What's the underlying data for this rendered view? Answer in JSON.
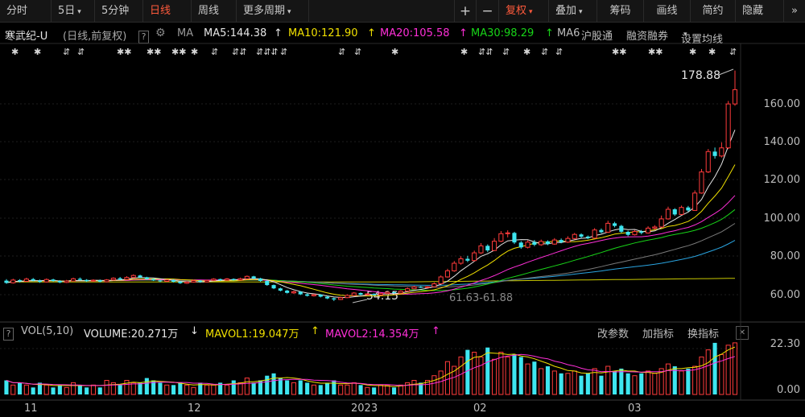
{
  "toolbar": {
    "tabs": [
      {
        "label": "分时",
        "active": false
      },
      {
        "label": "5日",
        "active": false,
        "caret": true
      },
      {
        "label": "5分钟",
        "active": false
      },
      {
        "label": "日线",
        "active": true
      },
      {
        "label": "周线",
        "active": false
      },
      {
        "label": "更多周期",
        "active": false,
        "caret": true
      }
    ],
    "zoom_in": "+",
    "zoom_out": "−",
    "fuquan": "复权",
    "overlay": "叠加",
    "chips": "筹码",
    "draw": "画线",
    "simple": "简约",
    "hide": "隐藏",
    "expand": "»"
  },
  "info": {
    "stock_name": "寒武纪-U",
    "desc": "(日线,前复权)",
    "help": "?",
    "ma_label": "MA",
    "ma5": "MA5:144.38",
    "ma10": "MA10:121.90",
    "ma20": "MA20:105.58",
    "ma30": "MA30:98.29",
    "ma6": "MA6",
    "hugutong": "沪股通",
    "rongzi": "融资融券",
    "settings": "设置均线"
  },
  "volume_info": {
    "vol": "VOL(5,10)",
    "volume": "VOLUME:20.271万",
    "mavol1": "MAVOL1:19.047万",
    "mavol2": "MAVOL2:14.354万",
    "edit_params": "改参数",
    "add_indicator": "加指标",
    "switch_indicator": "换指标",
    "close": "✕"
  },
  "colors": {
    "up": "#ff3b3b",
    "down": "#3ee6f0",
    "ma5": "#e6e6e6",
    "ma10": "#f0e000",
    "ma20": "#ff2fd8",
    "ma30": "#18d418",
    "ma60": "#7a7a7a",
    "ma120": "#2aa4e0",
    "ma250": "#c8c800"
  },
  "chart_data": {
    "type": "candlestick",
    "price_axis_ticks": [
      "160.00",
      "140.00",
      "120.00",
      "100.00",
      "80.00",
      "60.00"
    ],
    "volume_axis_ticks": [
      "22.30",
      "0.00"
    ],
    "x_labels": [
      "11",
      "12",
      "2023",
      "02",
      "03"
    ],
    "annotations": {
      "high": "178.88",
      "low": "54.15",
      "range": "61.63-61.88"
    },
    "price_range": [
      55,
      180
    ],
    "candles": [
      [
        65.2,
        64.0,
        66.0,
        63.5
      ],
      [
        64.0,
        65.5,
        66.2,
        63.6
      ],
      [
        65.5,
        64.8,
        66.0,
        64.2
      ],
      [
        64.8,
        66.0,
        66.8,
        64.5
      ],
      [
        66.0,
        65.2,
        66.6,
        64.8
      ],
      [
        65.2,
        64.5,
        65.8,
        64.0
      ],
      [
        64.5,
        65.8,
        66.4,
        64.2
      ],
      [
        65.8,
        65.0,
        66.2,
        64.6
      ],
      [
        65.0,
        64.2,
        65.5,
        63.8
      ],
      [
        64.2,
        65.0,
        65.6,
        63.9
      ],
      [
        65.0,
        66.2,
        66.8,
        64.8
      ],
      [
        66.2,
        65.6,
        66.9,
        65.2
      ],
      [
        65.6,
        64.9,
        66.0,
        64.5
      ],
      [
        64.9,
        65.4,
        65.9,
        64.5
      ],
      [
        65.4,
        64.6,
        65.8,
        64.2
      ],
      [
        64.6,
        65.6,
        66.0,
        64.3
      ],
      [
        65.6,
        66.5,
        67.0,
        65.3
      ],
      [
        66.5,
        65.8,
        67.2,
        65.4
      ],
      [
        65.8,
        66.9,
        67.6,
        65.6
      ],
      [
        66.9,
        68.0,
        68.6,
        66.5
      ],
      [
        68.0,
        67.0,
        68.4,
        66.6
      ],
      [
        67.0,
        66.0,
        67.3,
        65.6
      ],
      [
        66.0,
        65.3,
        66.4,
        65.0
      ],
      [
        65.3,
        64.8,
        65.6,
        64.3
      ],
      [
        64.8,
        65.6,
        66.0,
        64.5
      ],
      [
        65.6,
        64.6,
        65.9,
        64.2
      ],
      [
        64.6,
        63.8,
        65.0,
        63.4
      ],
      [
        63.8,
        64.4,
        64.8,
        63.4
      ],
      [
        64.4,
        65.2,
        65.6,
        64.1
      ],
      [
        65.2,
        64.5,
        65.5,
        64.0
      ],
      [
        64.5,
        65.3,
        65.7,
        64.2
      ],
      [
        65.3,
        66.0,
        66.5,
        65.0
      ],
      [
        66.0,
        65.4,
        66.3,
        65.0
      ],
      [
        65.4,
        66.1,
        66.6,
        65.1
      ],
      [
        66.1,
        65.5,
        66.4,
        65.2
      ],
      [
        65.5,
        66.2,
        66.8,
        65.2
      ],
      [
        66.2,
        67.5,
        68.0,
        66.0
      ],
      [
        67.5,
        66.4,
        67.8,
        66.0
      ],
      [
        66.4,
        65.0,
        66.7,
        64.6
      ],
      [
        65.0,
        62.8,
        65.3,
        62.4
      ],
      [
        62.8,
        61.0,
        63.1,
        60.6
      ],
      [
        61.0,
        59.8,
        61.4,
        59.4
      ],
      [
        59.8,
        58.6,
        60.2,
        58.2
      ],
      [
        58.6,
        59.2,
        59.8,
        58.0
      ],
      [
        59.2,
        57.8,
        59.5,
        57.4
      ],
      [
        57.8,
        57.0,
        58.2,
        56.6
      ],
      [
        57.0,
        57.6,
        58.0,
        56.6
      ],
      [
        57.6,
        56.5,
        57.9,
        56.1
      ],
      [
        56.5,
        55.6,
        56.9,
        55.2
      ],
      [
        55.6,
        55.0,
        56.0,
        54.15
      ],
      [
        55.0,
        56.0,
        56.5,
        54.7
      ],
      [
        56.0,
        57.2,
        57.8,
        55.8
      ],
      [
        57.2,
        58.5,
        59.0,
        57.0
      ],
      [
        58.5,
        57.6,
        58.8,
        57.2
      ],
      [
        57.6,
        58.0,
        58.4,
        57.2
      ],
      [
        58.0,
        57.4,
        58.3,
        57.0
      ],
      [
        57.4,
        58.2,
        58.7,
        57.1
      ],
      [
        58.2,
        58.9,
        59.3,
        58.0
      ],
      [
        58.9,
        58.5,
        59.2,
        58.1
      ],
      [
        58.5,
        59.5,
        60.0,
        58.3
      ],
      [
        59.5,
        60.8,
        61.5,
        59.3
      ],
      [
        60.8,
        61.8,
        62.4,
        60.6
      ],
      [
        61.8,
        61.6,
        62.3,
        61.2
      ],
      [
        61.6,
        61.88,
        62.2,
        61.3
      ],
      [
        61.9,
        63.5,
        64.2,
        61.7
      ],
      [
        63.5,
        67.2,
        68.0,
        63.2
      ],
      [
        67.2,
        70.5,
        71.6,
        66.8
      ],
      [
        70.5,
        74.6,
        75.8,
        70.0
      ],
      [
        74.6,
        77.0,
        78.4,
        73.8
      ],
      [
        77.0,
        76.0,
        78.6,
        75.2
      ],
      [
        76.0,
        80.2,
        81.4,
        75.6
      ],
      [
        80.2,
        84.0,
        85.5,
        79.6
      ],
      [
        84.0,
        81.5,
        84.8,
        80.6
      ],
      [
        81.5,
        86.5,
        88.2,
        81.2
      ],
      [
        86.5,
        90.6,
        92.0,
        86.0
      ],
      [
        90.6,
        91.0,
        92.4,
        88.6
      ],
      [
        91.0,
        85.8,
        91.6,
        85.0
      ],
      [
        85.8,
        83.2,
        86.6,
        82.4
      ],
      [
        83.2,
        86.0,
        87.0,
        82.6
      ],
      [
        86.0,
        84.6,
        87.2,
        83.8
      ],
      [
        84.6,
        86.4,
        87.4,
        84.0
      ],
      [
        86.4,
        85.0,
        87.0,
        84.4
      ],
      [
        85.0,
        87.2,
        88.2,
        84.6
      ],
      [
        87.2,
        86.0,
        88.0,
        85.4
      ],
      [
        86.0,
        88.0,
        89.2,
        85.6
      ],
      [
        88.0,
        90.2,
        91.0,
        87.5
      ],
      [
        90.2,
        89.0,
        90.8,
        88.2
      ],
      [
        89.0,
        88.2,
        89.6,
        87.6
      ],
      [
        88.2,
        92.6,
        93.6,
        88.0
      ],
      [
        92.6,
        91.4,
        93.4,
        90.8
      ],
      [
        91.4,
        96.2,
        97.6,
        91.0
      ],
      [
        96.2,
        94.8,
        97.0,
        94.0
      ],
      [
        94.8,
        91.6,
        95.4,
        91.0
      ],
      [
        91.6,
        90.0,
        92.2,
        89.2
      ],
      [
        90.0,
        91.8,
        92.6,
        89.6
      ],
      [
        91.8,
        91.0,
        92.6,
        90.2
      ],
      [
        91.0,
        93.6,
        94.6,
        90.6
      ],
      [
        93.6,
        94.2,
        95.2,
        92.8
      ],
      [
        94.2,
        98.6,
        100.4,
        93.8
      ],
      [
        98.6,
        103.8,
        105.2,
        98.2
      ],
      [
        103.8,
        101.0,
        104.4,
        100.2
      ],
      [
        101.0,
        104.8,
        105.8,
        100.6
      ],
      [
        104.8,
        103.2,
        105.6,
        102.4
      ],
      [
        103.2,
        112.6,
        114.0,
        103.0
      ],
      [
        112.6,
        124.0,
        125.6,
        112.2
      ],
      [
        124.0,
        135.0,
        136.4,
        123.4
      ],
      [
        135.0,
        132.6,
        137.2,
        131.2
      ],
      [
        132.6,
        137.0,
        140.0,
        131.8
      ],
      [
        137.0,
        160.8,
        162.4,
        136.4
      ],
      [
        160.8,
        168.5,
        178.88,
        159.8
      ]
    ],
    "volumes": [
      6,
      4,
      5,
      4,
      3,
      5,
      4,
      3,
      4,
      3,
      5,
      4,
      3,
      4,
      3,
      6,
      5,
      4,
      6,
      5,
      5,
      7,
      6,
      5,
      4,
      4,
      5,
      4,
      3,
      5,
      4,
      4,
      5,
      4,
      6,
      5,
      7,
      5,
      6,
      8,
      9,
      7,
      6,
      5,
      6,
      5,
      4,
      4,
      5,
      6,
      4,
      4,
      5,
      4,
      3,
      3,
      4,
      4,
      3,
      4,
      5,
      6,
      5,
      6,
      8,
      10,
      14,
      12,
      16,
      19,
      18,
      16,
      20,
      15,
      18,
      16,
      17,
      16,
      13,
      14,
      11,
      12,
      10,
      9,
      9,
      10,
      8,
      9,
      11,
      8,
      12,
      10,
      11,
      9,
      8,
      9,
      10,
      9,
      11,
      13,
      12,
      10,
      11,
      12,
      16,
      19,
      22,
      17,
      21,
      22
    ]
  }
}
